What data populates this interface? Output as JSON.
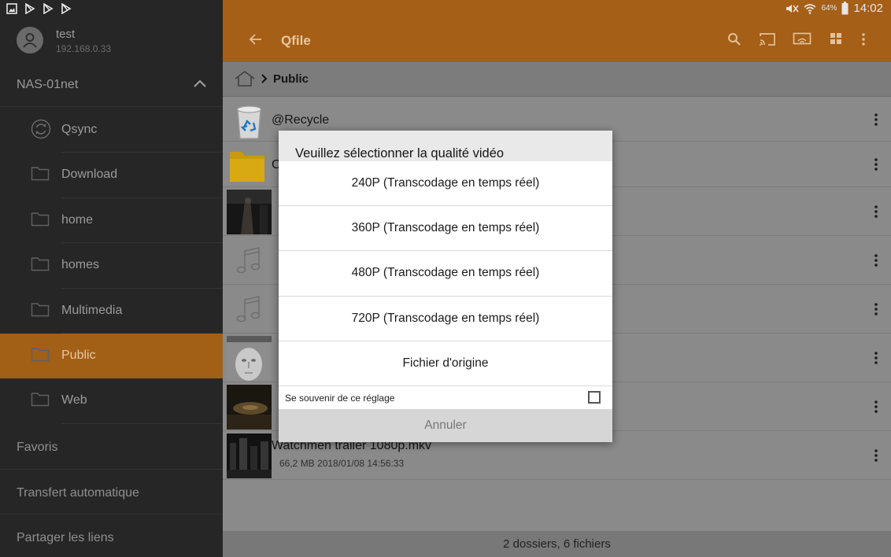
{
  "status_bar": {
    "battery": "64%",
    "time": "14:02"
  },
  "drawer": {
    "user": {
      "name": "test",
      "ip": "192.168.0.33"
    },
    "nas": {
      "label": "NAS-01net"
    },
    "shares": [
      {
        "label": "Qsync",
        "icon": "qsync-icon",
        "active": false
      },
      {
        "label": "Download",
        "icon": "folder-icon",
        "active": false
      },
      {
        "label": "home",
        "icon": "folder-icon",
        "active": false
      },
      {
        "label": "homes",
        "icon": "folder-icon",
        "active": false
      },
      {
        "label": "Multimedia",
        "icon": "folder-icon",
        "active": false
      },
      {
        "label": "Public",
        "icon": "folder-icon",
        "active": true
      },
      {
        "label": "Web",
        "icon": "folder-icon",
        "active": false
      }
    ],
    "menu": [
      {
        "label": "Favoris"
      },
      {
        "label": "Transfert automatique"
      },
      {
        "label": "Partager les liens"
      }
    ]
  },
  "app_bar": {
    "title": "Qfile",
    "icons": [
      "search-icon",
      "cast-icon",
      "stream-icon",
      "grid-view-icon",
      "more-vertical-icon"
    ]
  },
  "breadcrumb": {
    "current": "Public"
  },
  "file_list": [
    {
      "name": "@Recycle",
      "meta": "",
      "type": "recycle"
    },
    {
      "name": "C",
      "meta": "",
      "type": "folder"
    },
    {
      "name": "",
      "meta": "",
      "type": "video-dark"
    },
    {
      "name": "",
      "meta": "",
      "type": "music"
    },
    {
      "name": "",
      "meta": "",
      "type": "music"
    },
    {
      "name": "",
      "meta": "",
      "type": "album-face"
    },
    {
      "name": "",
      "meta": "",
      "type": "video-bronze"
    },
    {
      "name": "Watchmen trailer 1080p.mkv",
      "meta": "66,2 MB  2018/01/08 14:56:33",
      "type": "video-city"
    }
  ],
  "footer": {
    "summary": "2 dossiers, 6 fichiers"
  },
  "dialog": {
    "title": "Veuillez sélectionner la qualité vidéo",
    "options": [
      "240P (Transcodage en temps réel)",
      "360P (Transcodage en temps réel)",
      "480P (Transcodage en temps réel)",
      "720P (Transcodage en temps réel)",
      "Fichier d'origine"
    ],
    "remember_label": "Se souvenir de ce réglage",
    "remember_checked": false,
    "cancel_label": "Annuler"
  },
  "colors": {
    "accent": "#a55f17",
    "drawer_bg": "#262626",
    "active_item": "#a25f16"
  }
}
